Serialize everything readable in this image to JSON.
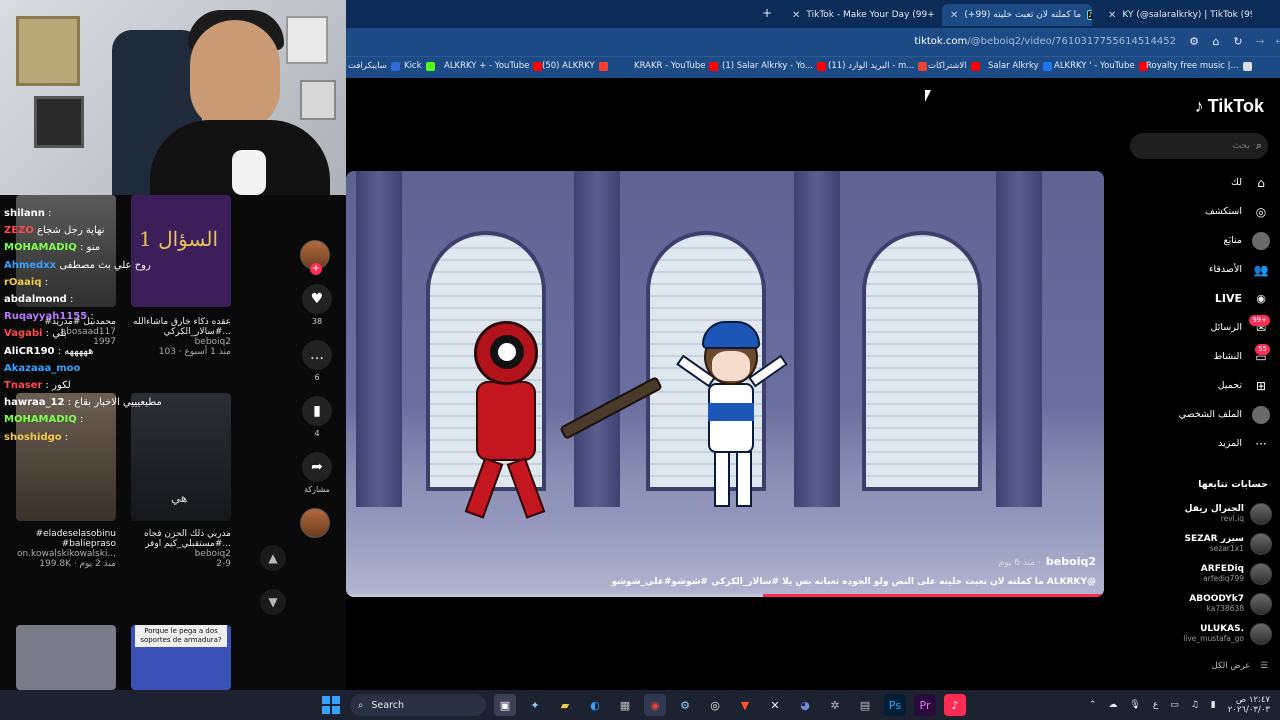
{
  "browser": {
    "tabs": [
      {
        "label": "TikTok - Make Your Day (99+)"
      },
      {
        "label": "ما كملته لان تعبت خليته (99+)"
      },
      {
        "label": "KY (@salaralkrky) | TikTok (99+)"
      }
    ],
    "new_tab": "+",
    "close": "✕",
    "url_host": "tiktok.com",
    "url_path": "/@beboiq2/video/7610317755614514452",
    "bookmarks": [
      {
        "label": "سايبكرافت",
        "color": "#2e6bd6"
      },
      {
        "label": "Kick",
        "color": "#53fc18"
      },
      {
        "label": "ALKRKY + - YouTube",
        "color": "#ff0000"
      },
      {
        "label": "(50) ALKRKY",
        "color": "#ff3b30"
      },
      {
        "label": "KRAKR - YouTube",
        "color": "#ff0000"
      },
      {
        "label": "(1) Salar Alkrky - Yo...",
        "color": "#ff0000"
      },
      {
        "label": "(11) البريد الوارد - m...",
        "color": "#ea4335"
      },
      {
        "label": "الاشتراكات",
        "color": "#ff0000"
      },
      {
        "label": "Salar Alkrky",
        "color": "#1877f2"
      },
      {
        "label": "ALKRKY ' - YouTube",
        "color": "#ff0000"
      },
      {
        "label": "Royalty free music |...",
        "color": "#dddddd"
      }
    ]
  },
  "tiktok": {
    "logo": "TikTok",
    "search_placeholder": "بحث",
    "nav": [
      {
        "label": "لك",
        "icon": "home-icon",
        "glyph": "⌂"
      },
      {
        "label": "استكشف",
        "icon": "compass-icon",
        "glyph": "◎"
      },
      {
        "label": "متابَع",
        "icon": "following-avatar-icon",
        "glyph": "●"
      },
      {
        "label": "الأصدقاء",
        "icon": "friends-icon",
        "glyph": "👥"
      },
      {
        "label": "LIVE",
        "icon": "live-icon",
        "glyph": "◉"
      },
      {
        "label": "الرسائل",
        "icon": "messages-icon",
        "glyph": "✉",
        "badge": "99+"
      },
      {
        "label": "النشاط",
        "icon": "activity-icon",
        "glyph": "▭",
        "badge": "55"
      },
      {
        "label": "تحميل",
        "icon": "upload-icon",
        "glyph": "⊞"
      },
      {
        "label": "الملف الشخصي",
        "icon": "profile-avatar-icon",
        "glyph": "●"
      },
      {
        "label": "المزيد",
        "icon": "more-icon",
        "glyph": "···"
      }
    ],
    "following_title": "حسابات تتابعها",
    "following": [
      {
        "name": "الجنرال ريفل",
        "handle": "revl.iq"
      },
      {
        "name": "SEZAR سيزر",
        "handle": "sezar1x1"
      },
      {
        "name": "ARFEDiq",
        "handle": "arfediq799"
      },
      {
        "name": "ABOODYk7",
        "handle": "ka738638"
      },
      {
        "name": "ULUKAS.",
        "handle": "live_mustafa_go"
      }
    ],
    "see_all": "عرض الكل",
    "video": {
      "author": "beboiq2",
      "date": "منذ 6 يوم ·",
      "caption": "ما كملته لان تعبت خليته على النص ولو الجوده تعبانه بس يلا #سالار_الكركي #شوشو#علي_شوشو ALKRKY@",
      "progress_fraction": 0.45
    }
  },
  "overlay": {
    "chat": [
      {
        "name": "shilann",
        "msg": ":",
        "color": "#ffffff"
      },
      {
        "name": "ZEZO",
        "msg": "نهاية رجل شجاع",
        "color": "#ff4b4b"
      },
      {
        "name": "MOHAMADIQ",
        "msg": ": منو",
        "color": "#7cff4f"
      },
      {
        "name": "Ahmedxx",
        "msg": "روح علي بث مصطفى",
        "color": "#3aa0ff"
      },
      {
        "name": "rOaaiq",
        "msg": ":",
        "color": "#f2c94c"
      },
      {
        "name": "abdalmond",
        "msg": ":",
        "color": "#ffffff"
      },
      {
        "name": "Ruqayyah1155",
        "msg": ":",
        "color": "#b57cff"
      },
      {
        "name": "Vagabi",
        "msg": ": بلي",
        "color": "#ff4b4b"
      },
      {
        "name": "AliCR190",
        "msg": ": هههههه",
        "color": "#ffffff"
      },
      {
        "name": "Akazaaa_moo",
        "msg": "",
        "color": "#3aa0ff"
      },
      {
        "name": "Tnaser",
        "msg": ": لكور",
        "color": "#ff4b4b"
      },
      {
        "name": "hawraa_12",
        "msg": ": مطيعيييي الاخبار بقاع",
        "color": "#ffffff"
      },
      {
        "name": "MOHAMADIQ",
        "msg": ":",
        "color": "#7cff4f"
      },
      {
        "name": "shoshidgo",
        "msg": ":",
        "color": "#f2c94c"
      }
    ],
    "grid": [
      {
        "caption": "#محمدنيل #مدريد",
        "author": "abosaad117",
        "stat": "1997"
      },
      {
        "caption": "عقده ذكاء خارق ماشاءالله #سالار_الكركي...",
        "author": "beboiq2",
        "stat": "103 · منذ 1 أسبوع",
        "overlay_text": "السؤال 1"
      },
      {
        "caption": "#eladeselasobinu #balieprasо",
        "author": "on.kowalskikowalski...",
        "stat": "199.8K · منذ 2 يوم"
      },
      {
        "caption": "مدربي ذلك الحزن فجاه #مستقبلي_كيم اوفر...",
        "author": "beboiq2",
        "stat": "2-9",
        "overlay_text": "هي"
      },
      {
        "caption": "",
        "author": "",
        "stat": ""
      },
      {
        "caption": "",
        "author": "",
        "stat": "",
        "overlay_text": "Porque le pega a dos soportes de armadura?"
      }
    ],
    "actions": {
      "likes": "38",
      "comments": "6",
      "saves": "4",
      "share": "مشاركة"
    },
    "arrows": {
      "up": "▲",
      "down": "▼"
    }
  },
  "taskbar": {
    "search": "Search",
    "time": "١٢:٤٧ ص",
    "date": "٢٠٢٦/٠٣/٠٣",
    "lang": "ع"
  }
}
